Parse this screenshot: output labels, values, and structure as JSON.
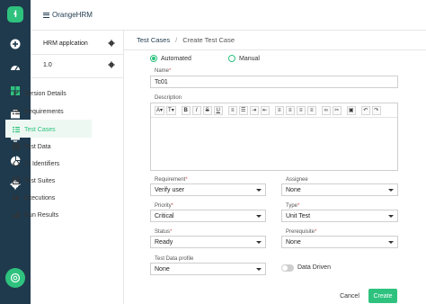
{
  "brand": {
    "name": "OrangeHRM"
  },
  "rail": {
    "icons": [
      "plus-circle-icon",
      "dashboard-icon",
      "grid-icon",
      "briefcase-icon",
      "monitor-icon",
      "pie-chart-icon",
      "gear-icon"
    ],
    "active": "grid-icon"
  },
  "sidebar": {
    "project": "HRM applcation",
    "version": "1.0",
    "items": [
      {
        "label": "Version Details"
      },
      {
        "label": "Requirements"
      },
      {
        "label": "Test Cases",
        "active": true
      },
      {
        "label": "Test Data"
      },
      {
        "label": "UI Identifiers"
      },
      {
        "label": "Test Suites"
      },
      {
        "label": "Executions"
      },
      {
        "label": "Run Results"
      }
    ]
  },
  "breadcrumb": {
    "parent": "Test Cases",
    "separator": "/",
    "current": "Create Test Case"
  },
  "form": {
    "type_options": [
      "Automated",
      "Manual"
    ],
    "type_selected": "Automated",
    "name_label": "Name",
    "name_value": "Tc01",
    "description_label": "Description",
    "toolbar": {
      "font": "A",
      "size": "T",
      "bold": "B",
      "italic": "I",
      "strike": "S",
      "underline": "U"
    },
    "requirement_label": "Requirement",
    "requirement_value": "Verify user",
    "assignee_label": "Assignee",
    "assignee_value": "None",
    "priority_label": "Priority",
    "priority_value": "Critical",
    "type_label": "Type",
    "type_value": "Unit Test",
    "status_label": "Status",
    "status_value": "Ready",
    "prerequisite_label": "Prerequisite",
    "prerequisite_value": "None",
    "testdata_label": "Test Data profile",
    "testdata_value": "None",
    "data_driven_label": "Data Driven",
    "cancel_label": "Cancel",
    "create_label": "Create"
  },
  "colors": {
    "accent": "#2ec27e",
    "rail": "#1f3a4d",
    "required": "#d9534f"
  }
}
